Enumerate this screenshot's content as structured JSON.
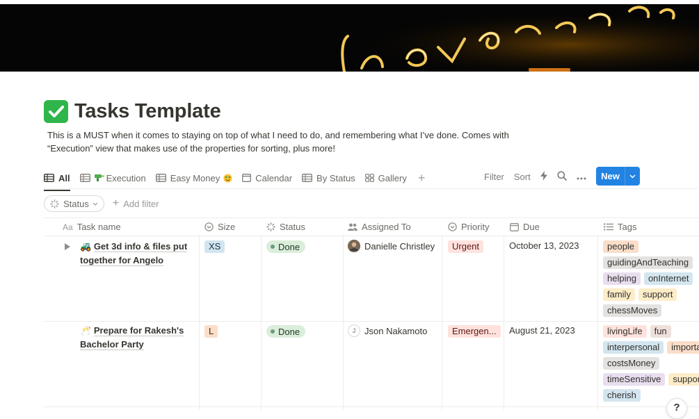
{
  "page": {
    "title": "Tasks Template",
    "description": "This is a MUST when it comes to staying on top of what I need to do, and remembering what I’ve done. Comes with “Execution” view that makes use of the properties for sorting, plus more!",
    "cover_text": "never stop"
  },
  "tabs": [
    {
      "label": "All",
      "icon": "table-icon"
    },
    {
      "label": "Execution",
      "icon": "table-icon"
    },
    {
      "label": "Easy Money",
      "icon": "table-icon"
    },
    {
      "label": "Calendar",
      "icon": "calendar-icon"
    },
    {
      "label": "By Status",
      "icon": "table-icon"
    },
    {
      "label": "Gallery",
      "icon": "gallery-icon"
    }
  ],
  "toolbar": {
    "filter": "Filter",
    "sort": "Sort",
    "new": "New"
  },
  "filters": {
    "status": "Status",
    "add_filter": "Add filter"
  },
  "columns": {
    "task": "Task name",
    "size": "Size",
    "status": "Status",
    "assigned": "Assigned To",
    "priority": "Priority",
    "due": "Due",
    "tags": "Tags"
  },
  "rows": [
    {
      "emoji": "🚜",
      "name_line1": "Get 3d info & files put",
      "name_line2": "together for Angelo",
      "size": "XS",
      "status": "Done",
      "assigned": "Danielle Christley",
      "priority": "Urgent",
      "due": "October 13, 2023",
      "tags": [
        [
          "people"
        ],
        [
          "guidingAndTeaching"
        ],
        [
          "helping",
          "onInternet"
        ],
        [
          "family",
          "support"
        ],
        [
          "chessMoves"
        ]
      ]
    },
    {
      "emoji": "🥂",
      "name_line1": "Prepare for Rakesh's",
      "name_line2": "Bachelor Party",
      "size": "L",
      "status": "Done",
      "assigned": "Json Nakamoto",
      "assigned_initial": "J",
      "priority": "Emergen...",
      "due": "August 21, 2023",
      "tags": [
        [
          "livingLife",
          "fun"
        ],
        [
          "interpersonal",
          "importa"
        ],
        [
          "costsMoney"
        ],
        [
          "timeSensitive",
          "suppor"
        ],
        [
          "cherish"
        ]
      ]
    }
  ],
  "colors": {
    "accent": "#2383e2",
    "tag_orange": "#fadec9",
    "tag_gray": "#e3e2e0",
    "tag_purple": "#e8deee",
    "tag_blue": "#d3e5ef",
    "tag_yellow": "#fdecc8",
    "tag_red": "#ffe2dd",
    "tag_brown": "#eee0da",
    "status_done": "#dbeddb"
  },
  "help": "?"
}
